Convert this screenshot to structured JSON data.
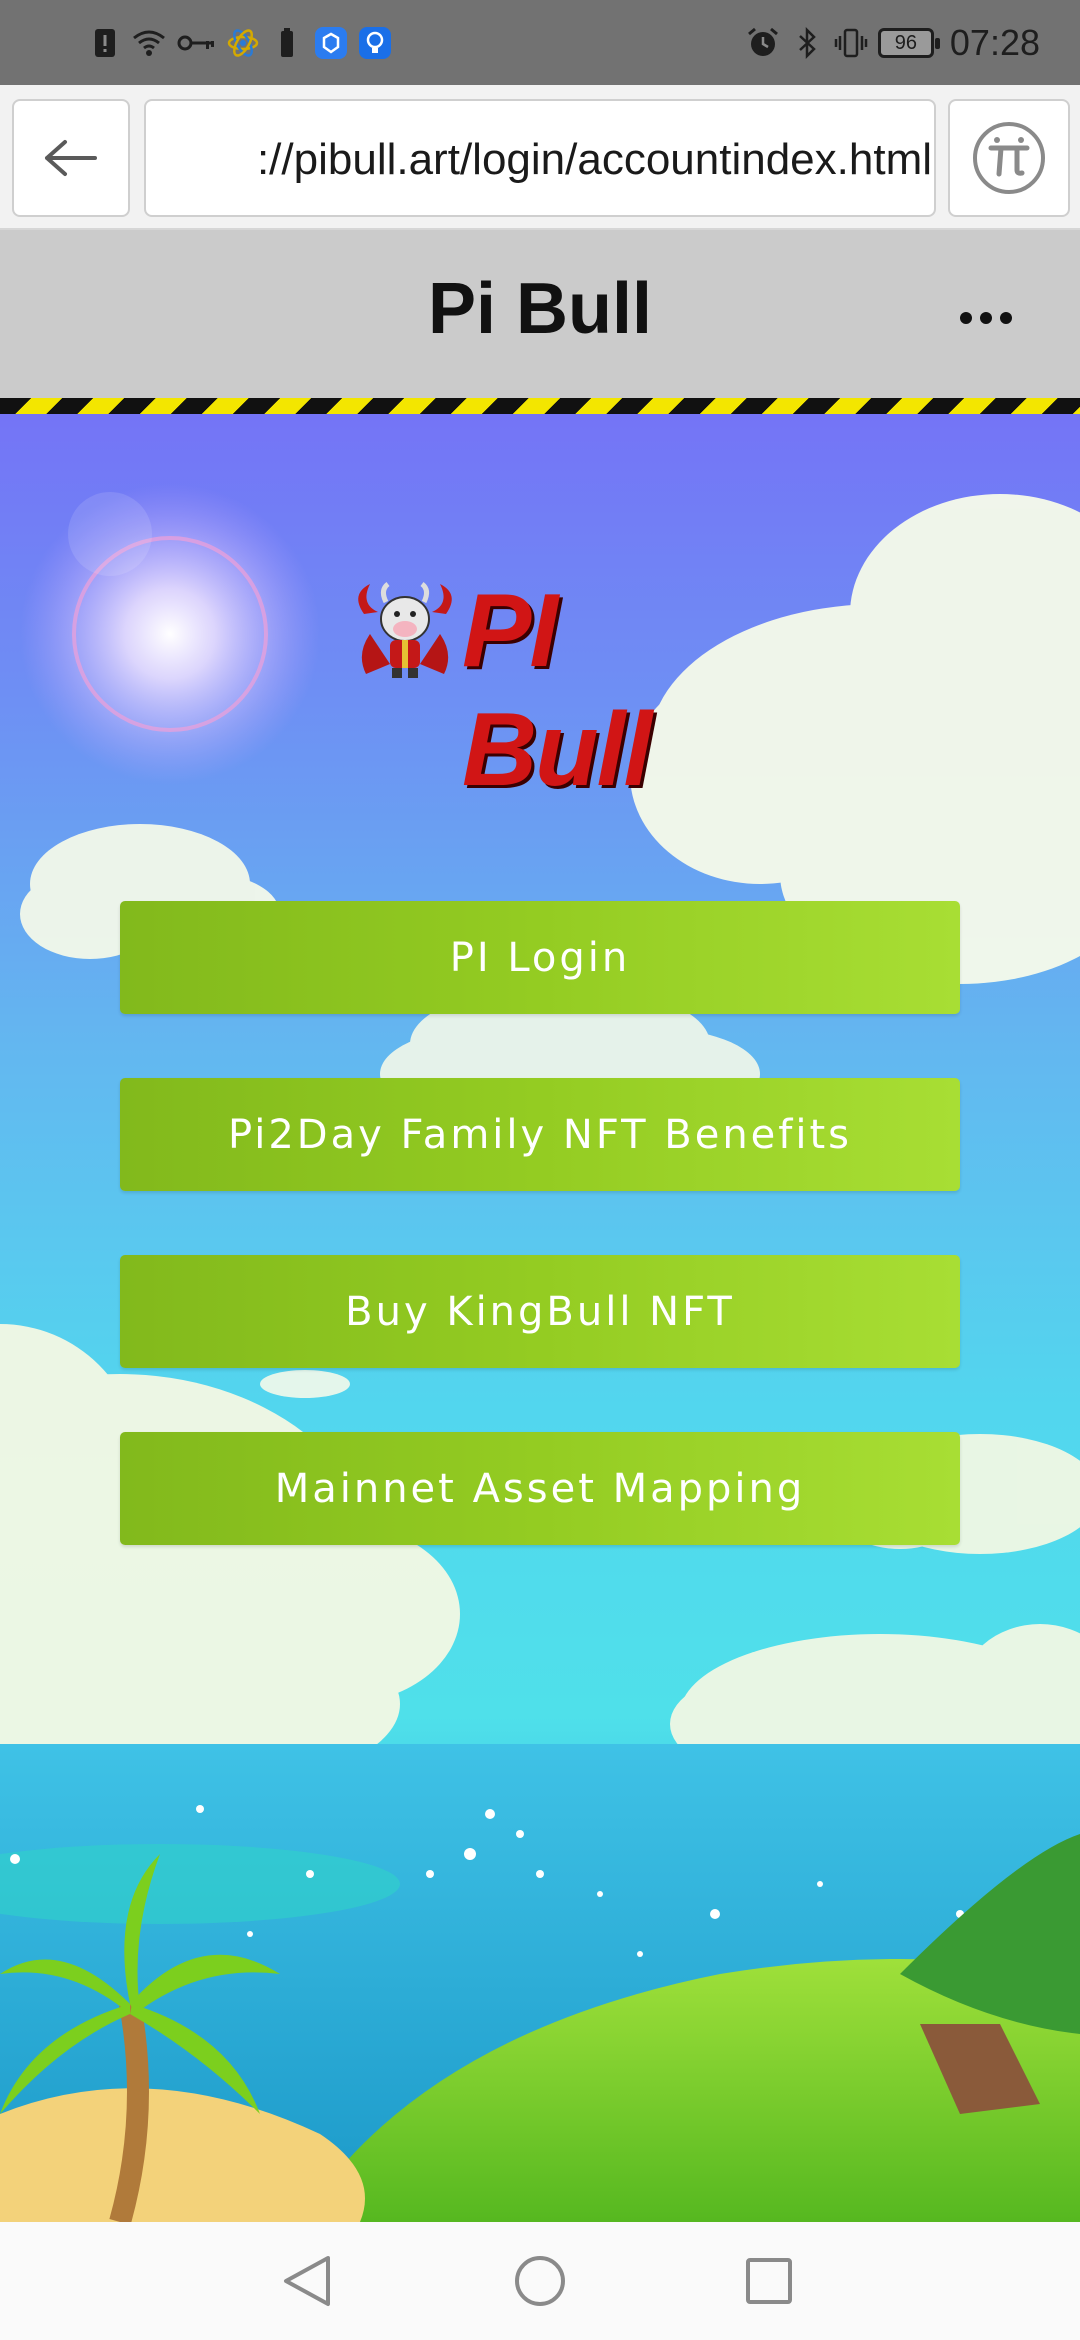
{
  "status_bar": {
    "time": "07:28",
    "battery": "96",
    "left_icons": [
      "alert-icon",
      "wifi-icon",
      "key-icon",
      "atom-icon",
      "battery-saver-icon",
      "app-icon",
      "bulb-icon"
    ],
    "right_icons": [
      "alarm-icon",
      "bluetooth-icon",
      "vibrate-icon"
    ]
  },
  "browser": {
    "url": "://pibull.art/login/accountindex.html"
  },
  "app": {
    "title": "Pi Bull"
  },
  "logo": {
    "text": "PI Bull"
  },
  "menu": {
    "buttons": [
      {
        "label": "PI Login"
      },
      {
        "label": "Pi2Day Family NFT Benefits"
      },
      {
        "label": "Buy KingBull NFT"
      },
      {
        "label": "Mainnet Asset Mapping"
      }
    ]
  },
  "colors": {
    "button": "#94cc22",
    "logo_red": "#d11515",
    "stripe_yellow": "#f3e600"
  }
}
